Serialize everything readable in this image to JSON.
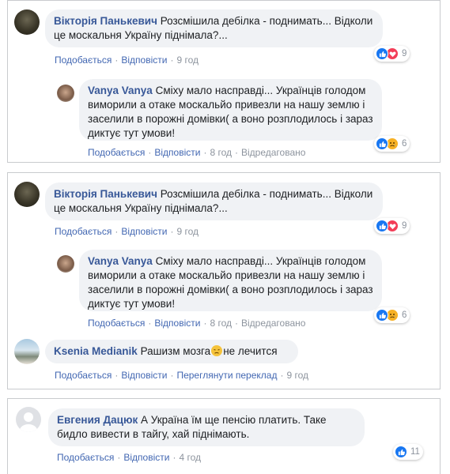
{
  "panel1": {
    "comment": {
      "author": "Вікторія Панькевич",
      "text": "Розсмішила дебілка - поднимать... Відколи це москальня Україну піднімала?...",
      "like": "Подобається",
      "reply": "Відповісти",
      "time": "9 год",
      "reactions": "9"
    },
    "reply": {
      "author": "Vanya Vanya",
      "text": "Сміху мало насправді... Українців голодом виморили а отаке москальйо привезли на нашу землю і заселили в порожні домівки( а воно розплодилось і зараз диктує тут умови!",
      "like": "Подобається",
      "reply": "Відповісти",
      "time": "8 год",
      "edited": "Відредаговано",
      "reactions": "6"
    }
  },
  "panel2": {
    "comment": {
      "author": "Вікторія Панькевич",
      "text": "Розсмішила дебілка - поднимать... Відколи це москальня Україну піднімала?...",
      "like": "Подобається",
      "reply": "Відповісти",
      "time": "9 год",
      "reactions": "9"
    },
    "reply": {
      "author": "Vanya Vanya",
      "text": "Сміху мало насправді... Українців голодом виморили а отаке москальйо привезли на нашу землю і заселили в порожні домівки( а воно розплодилось і зараз диктує тут умови!",
      "like": "Подобається",
      "reply": "Відповісти",
      "time": "8 год",
      "edited": "Відредаговано",
      "reactions": "6"
    },
    "comment2": {
      "author": "Ksenia Medianik",
      "text": "Рашизм мозга",
      "text_after": "не лечится",
      "like": "Подобається",
      "reply": "Відповісти",
      "translate": "Переглянути переклад",
      "time": "9 год"
    }
  },
  "panel3": {
    "comment": {
      "author": "Евгения Дацюк",
      "text": "А Україна їм ще пенсію платить. Таке бидло вивести в тайгу, хай піднімають.",
      "like": "Подобається",
      "reply": "Відповісти",
      "time": "4 год",
      "reactions": "11"
    }
  },
  "colors": {
    "link": "#385898",
    "like_blue": "#1877f2",
    "love_red": "#f33e58",
    "bubble": "#f0f2f5"
  },
  "icons": [
    "like-icon",
    "love-icon",
    "sad-icon",
    "emoji-sad-face"
  ]
}
